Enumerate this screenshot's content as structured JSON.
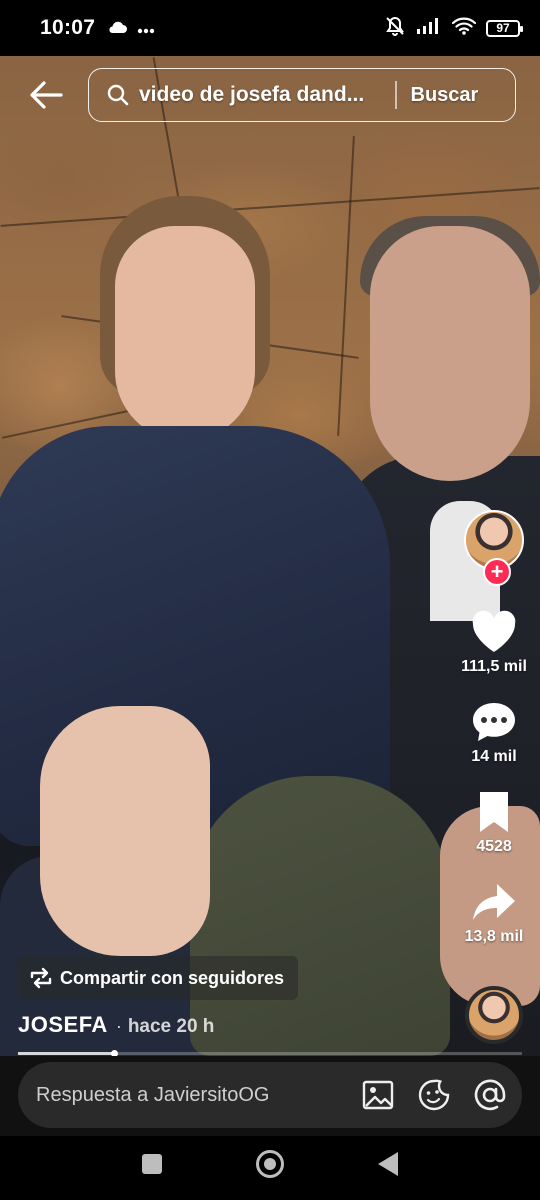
{
  "status_bar": {
    "time": "10:07",
    "left_icons": [
      "cloud-icon",
      "more-dots-icon"
    ],
    "right_icons": [
      "mute-bell-icon",
      "signal-icon",
      "wifi-icon"
    ],
    "battery": "97"
  },
  "search": {
    "query": "video de josefa dand...",
    "button_label": "Buscar"
  },
  "rail": {
    "likes": "111,5 mil",
    "comments": "14 mil",
    "saves": "4528",
    "shares": "13,8 mil"
  },
  "post": {
    "share_label": "Compartir con seguidores",
    "author": "JOSEFA",
    "separator": "·",
    "time_ago": "hace 20 h",
    "progress": 0.19
  },
  "reply": {
    "placeholder": "Respuesta a JaviersitoOG"
  },
  "colors": {
    "follow_accent": "#fe2c55",
    "reply_background": "#2a2a2a"
  }
}
